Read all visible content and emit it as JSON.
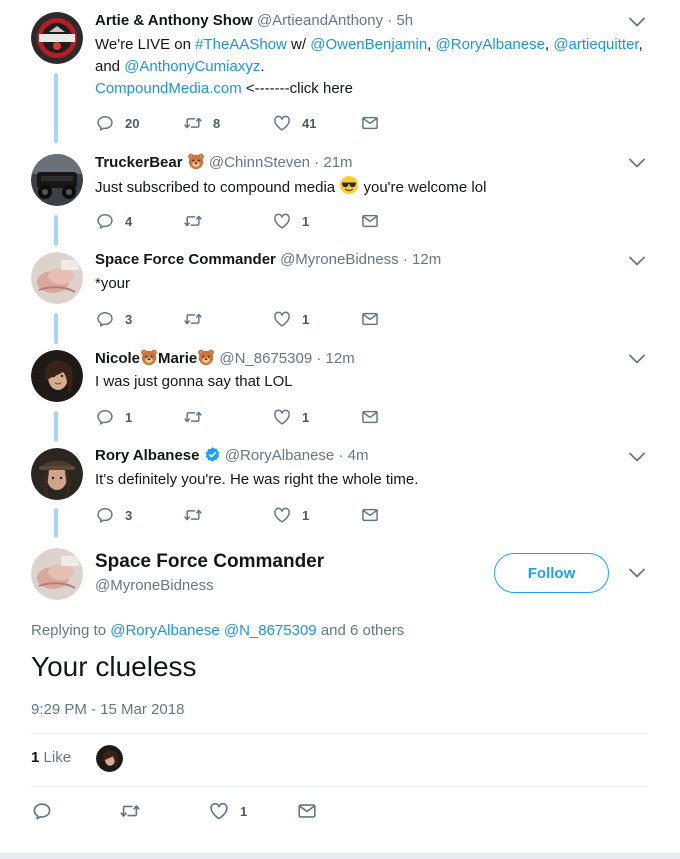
{
  "thread": [
    {
      "name": "Artie & Anthony Show",
      "handle": "@ArtieandAnthony",
      "time": "5h",
      "text_parts": {
        "p1": "We're LIVE on ",
        "tag": "#TheAAShow",
        "p2": " w/ ",
        "m1": "@OwenBenjamin",
        "c1": ", ",
        "m2": "@RoryAlbanese",
        "c2": ", ",
        "m3": "@artiequitter",
        "c3": ",",
        "p3": "and ",
        "m4": "@AnthonyCumiaxyz",
        "p4": ".",
        "link": "CompoundMedia.com",
        "p5": " <-------click here"
      },
      "replies": "20",
      "retweets": "8",
      "likes": "41"
    },
    {
      "name": "TruckerBear",
      "handle": "@ChinnSteven",
      "time": "21m",
      "text_a": "Just subscribed to compound media ",
      "text_b": " you're welcome lol",
      "replies": "4",
      "retweets": "",
      "likes": "1"
    },
    {
      "name": "Space Force Commander",
      "handle": "@MyroneBidness",
      "time": "12m",
      "text": "*your",
      "replies": "3",
      "retweets": "",
      "likes": "1"
    },
    {
      "name_a": "Nicole",
      "name_b": "Marie",
      "handle": "@N_8675309",
      "time": "12m",
      "text": "I was just gonna say that LOL",
      "replies": "1",
      "retweets": "",
      "likes": "1"
    },
    {
      "name": "Rory Albanese",
      "handle": "@RoryAlbanese",
      "time": "4m",
      "text": "It's definitely you're. He was right the whole time.",
      "replies": "3",
      "retweets": "",
      "likes": "1"
    }
  ],
  "main": {
    "name": "Space Force Commander",
    "handle": "@MyroneBidness",
    "follow_label": "Follow",
    "replying_prefix": "Replying to ",
    "replying_m1": "@RoryAlbanese",
    "replying_m2": "@N_8675309",
    "replying_suffix": " and 6 others",
    "text": "Your clueless",
    "timestamp": "9:29 PM - 15 Mar 2018",
    "like_count": "1",
    "like_label": "Like",
    "action_likes": "1"
  },
  "separator": " · ",
  "colors": {
    "link": "#1b95e0",
    "accent": "#1da1f2",
    "muted": "#657786",
    "thread_line": "#a9d6f5"
  },
  "icons": [
    "reply-icon",
    "retweet-icon",
    "like-icon",
    "dm-icon",
    "chevron-down-icon",
    "verified-icon",
    "bear-emoji",
    "sunglasses-emoji"
  ]
}
